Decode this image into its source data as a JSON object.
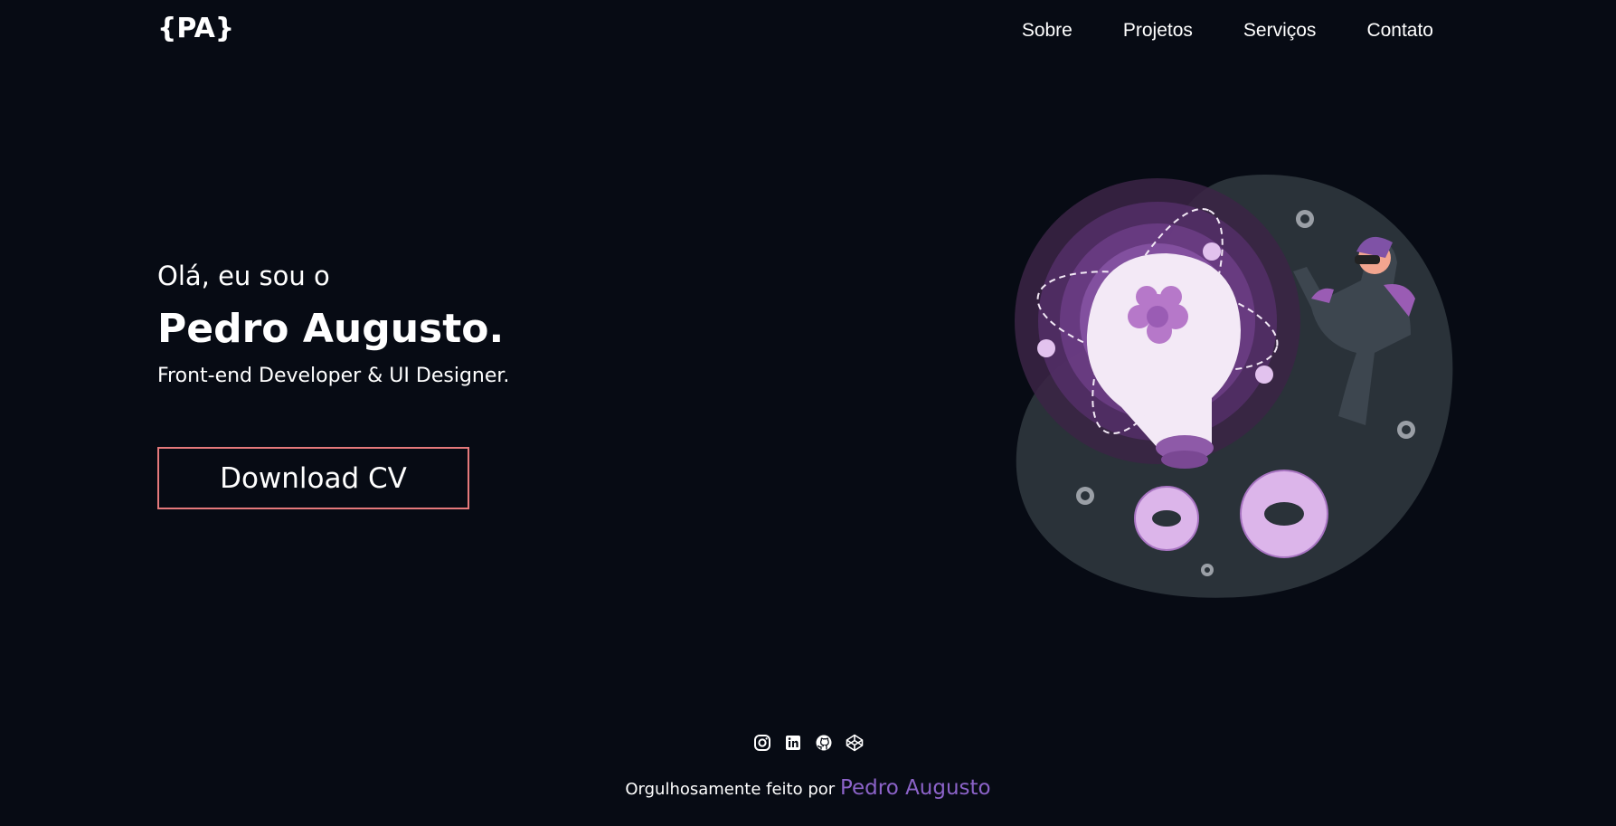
{
  "header": {
    "logo": "{PA}",
    "nav": [
      {
        "label": "Sobre"
      },
      {
        "label": "Projetos"
      },
      {
        "label": "Serviços"
      },
      {
        "label": "Contato"
      }
    ]
  },
  "hero": {
    "greeting": "Olá, eu sou o",
    "name": "Pedro Augusto.",
    "role": "Front-end Developer & UI Designer.",
    "cta_label": "Download CV"
  },
  "social": {
    "icons": [
      "instagram-icon",
      "linkedin-icon",
      "github-icon",
      "codepen-icon"
    ]
  },
  "footer": {
    "text": "Orgulhosamente feito por",
    "author": "Pedro Augusto"
  },
  "colors": {
    "background": "#070b14",
    "button_border": "#e5797b",
    "accent": "#8c63c9"
  }
}
